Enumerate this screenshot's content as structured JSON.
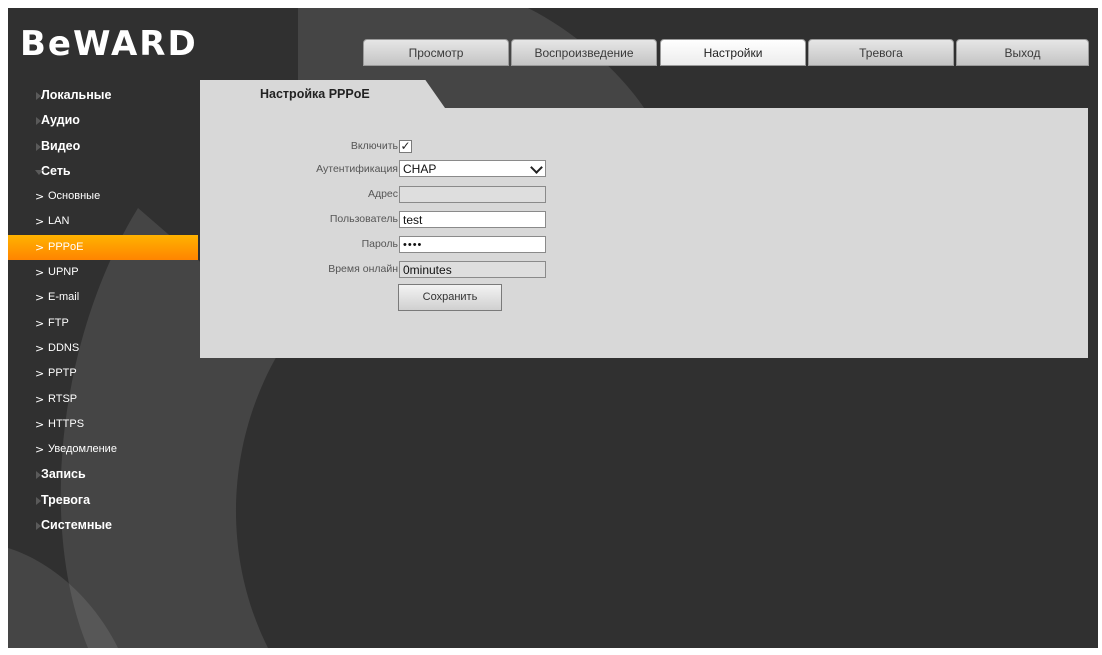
{
  "brand": {
    "logo_text": "BeWARD"
  },
  "nav": {
    "tabs": [
      {
        "label": "Просмотр",
        "active": false
      },
      {
        "label": "Воспроизведение",
        "active": false
      },
      {
        "label": "Настройки",
        "active": true
      },
      {
        "label": "Тревога",
        "active": false
      },
      {
        "label": "Выход",
        "active": false
      }
    ]
  },
  "sidebar": {
    "items": [
      {
        "label": "Локальные",
        "kind": "group"
      },
      {
        "label": "Аудио",
        "kind": "group"
      },
      {
        "label": "Видео",
        "kind": "group"
      },
      {
        "label": "Сеть",
        "kind": "group",
        "open": true
      },
      {
        "label": "Основные",
        "kind": "sub"
      },
      {
        "label": "LAN",
        "kind": "sub"
      },
      {
        "label": "PPPoE",
        "kind": "sub",
        "active": true
      },
      {
        "label": "UPNP",
        "kind": "sub"
      },
      {
        "label": "E-mail",
        "kind": "sub"
      },
      {
        "label": "FTP",
        "kind": "sub"
      },
      {
        "label": "DDNS",
        "kind": "sub"
      },
      {
        "label": "PPTP",
        "kind": "sub"
      },
      {
        "label": "RTSP",
        "kind": "sub"
      },
      {
        "label": "HTTPS",
        "kind": "sub"
      },
      {
        "label": "Уведомление",
        "kind": "sub"
      },
      {
        "label": "Запись",
        "kind": "group"
      },
      {
        "label": "Тревога",
        "kind": "group"
      },
      {
        "label": "Системные",
        "kind": "group"
      }
    ]
  },
  "panel": {
    "title": "Настройка PPPoE",
    "enable": {
      "label": "Включить",
      "checked": true,
      "mark": "✓"
    },
    "auth": {
      "label": "Аутентификация",
      "value": "CHAP"
    },
    "address": {
      "label": "Адрес",
      "value": ""
    },
    "user": {
      "label": "Пользователь",
      "value": "test"
    },
    "password": {
      "label": "Пароль",
      "value": "••••"
    },
    "online_time": {
      "label": "Время онлайн",
      "value": "0minutes"
    },
    "save_label": "Сохранить"
  },
  "colors": {
    "background": "#303030",
    "panel": "#d8d8d8",
    "accent": "#ff9a00"
  }
}
